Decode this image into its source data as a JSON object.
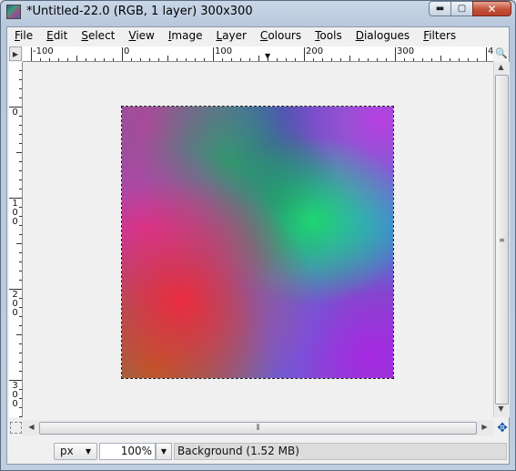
{
  "window": {
    "title": "*Untitled-22.0 (RGB, 1 layer) 300x300",
    "min_icon": "minimize-icon",
    "max_icon": "maximize-icon",
    "close_icon": "close-icon",
    "min_glyph": "▬",
    "max_glyph": "▢",
    "close_glyph": "✕"
  },
  "menubar": {
    "items": [
      {
        "label": "File",
        "mnemonic": "F",
        "rest": "ile"
      },
      {
        "label": "Edit",
        "mnemonic": "E",
        "rest": "dit"
      },
      {
        "label": "Select",
        "mnemonic": "S",
        "rest": "elect"
      },
      {
        "label": "View",
        "mnemonic": "V",
        "rest": "iew"
      },
      {
        "label": "Image",
        "mnemonic": "I",
        "rest": "mage"
      },
      {
        "label": "Layer",
        "mnemonic": "L",
        "rest": "ayer"
      },
      {
        "label": "Colours",
        "mnemonic": "C",
        "rest": "olours"
      },
      {
        "label": "Tools",
        "mnemonic": "T",
        "rest": "ools"
      },
      {
        "label": "Dialogues",
        "mnemonic": "D",
        "rest": "ialogues"
      },
      {
        "label": "Filters",
        "mnemonic": "F",
        "rest": "ilters"
      }
    ]
  },
  "rulers": {
    "horizontal_labels": [
      "-100",
      "0",
      "100",
      "200",
      "300",
      "4"
    ],
    "vertical_labels": [
      [
        "0"
      ],
      [
        "1",
        "0",
        "0"
      ],
      [
        "2",
        "0",
        "0"
      ],
      [
        "3",
        "0",
        "0"
      ]
    ],
    "corner_glyph": "▶",
    "zoom_glyph": "🔍",
    "pointer_glyph": "▼"
  },
  "canvas": {
    "image_size": "300x300",
    "layer": "Background"
  },
  "scrollbars": {
    "up_glyph": "▲",
    "down_glyph": "▼",
    "left_glyph": "◀",
    "right_glyph": "▶",
    "grip_v": "≡",
    "grip_h": "⦀"
  },
  "statusbar": {
    "unit": "px",
    "unit_arrow": "▼",
    "zoom": "100%",
    "zoom_arrow": "▼",
    "status": "Background (1.52 MB)"
  },
  "nav_glyph": "✥"
}
